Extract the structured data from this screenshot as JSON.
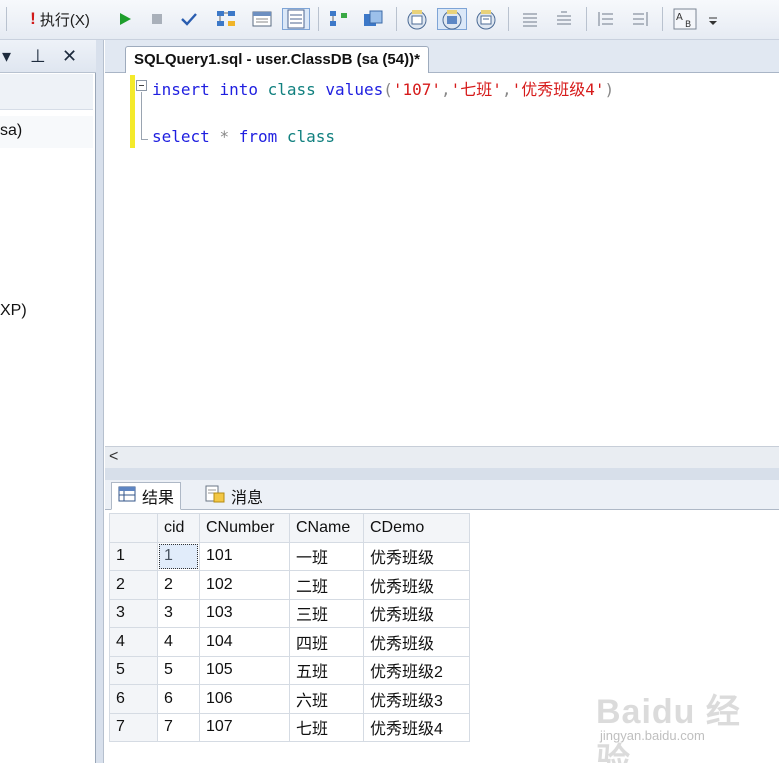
{
  "toolbar": {
    "execute_label": "执行(X)",
    "icons": [
      "execute-icon",
      "run-icon",
      "stop-icon",
      "parse-icon",
      "display-plan-icon",
      "query-options-icon",
      "results-to-grid-icon",
      "include-plan-icon",
      "client-stats-icon",
      "query-designer-icon",
      "results-to-text-icon",
      "results-to-file-icon",
      "comment-icon",
      "uncomment-icon",
      "decrease-indent-icon",
      "increase-indent-icon",
      "specify-values-icon"
    ]
  },
  "left_pane": {
    "items": [
      "sa)",
      "XP)"
    ]
  },
  "editor": {
    "tab_title": "SQLQuery1.sql - user.ClassDB (sa (54))*",
    "line1": {
      "kw1": "insert",
      "kw2": "into",
      "table": "class",
      "kw3": "values",
      "open": "(",
      "v1": "'107'",
      "c1": ",",
      "v2": "'七班'",
      "c2": ",",
      "v3": "'优秀班级4'",
      "close": ")"
    },
    "line2": {
      "kw1": "select",
      "star": "*",
      "kw2": "from",
      "table": "class"
    }
  },
  "results": {
    "tabs": [
      {
        "label": "结果",
        "icon": "grid-icon"
      },
      {
        "label": "消息",
        "icon": "messages-icon"
      }
    ],
    "columns": [
      "cid",
      "CNumber",
      "CName",
      "CDemo"
    ],
    "rows": [
      {
        "n": "1",
        "cid": "1",
        "cnumber": "101",
        "cname": "一班",
        "cdemo": "优秀班级"
      },
      {
        "n": "2",
        "cid": "2",
        "cnumber": "102",
        "cname": "二班",
        "cdemo": "优秀班级"
      },
      {
        "n": "3",
        "cid": "3",
        "cnumber": "103",
        "cname": "三班",
        "cdemo": "优秀班级"
      },
      {
        "n": "4",
        "cid": "4",
        "cnumber": "104",
        "cname": "四班",
        "cdemo": "优秀班级"
      },
      {
        "n": "5",
        "cid": "5",
        "cnumber": "105",
        "cname": "五班",
        "cdemo": "优秀班级2"
      },
      {
        "n": "6",
        "cid": "6",
        "cnumber": "106",
        "cname": "六班",
        "cdemo": "优秀班级3"
      },
      {
        "n": "7",
        "cid": "7",
        "cnumber": "107",
        "cname": "七班",
        "cdemo": "优秀班级4"
      }
    ]
  },
  "watermark": {
    "main": "Baidu 经验",
    "sub": "jingyan.baidu.com"
  },
  "colors": {
    "keyword": "#1f1fe0",
    "identifier": "#11807f",
    "string": "#d61a1a",
    "change_marker": "#f4ea2b"
  }
}
